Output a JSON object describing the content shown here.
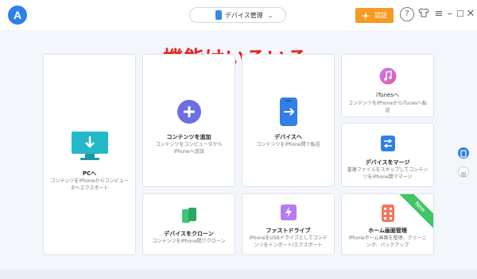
{
  "header": {
    "device_label": "デバイス管理",
    "device_chevron": "⌄",
    "auth_label": "認証"
  },
  "headline": "機能はいろいろ",
  "cards": {
    "pc": {
      "title": "PCへ",
      "desc": "コンテンツをiPhoneからコンピュータへエクスポート"
    },
    "add": {
      "title": "コンテンツを追加",
      "desc": "コンテンツをコンピュータからiPhoneへ追加"
    },
    "device": {
      "title": "デバイスへ",
      "desc": "コンテンツをiPhone間で転送"
    },
    "itunes": {
      "title": "iTunesへ",
      "desc": "コンテンツをiPhoneからiTunesへ転送"
    },
    "merge": {
      "title": "デバイスをマージ",
      "desc": "重複ファイルをスキップしてコンテンツをiPhone間でマージ"
    },
    "clone": {
      "title": "デバイスをクローン",
      "desc": "コンテンツをiPhone間でクローン"
    },
    "drive": {
      "title": "ファストドライブ",
      "desc": "iPhoneをUSBドライブとしてコンテンツをインポート/エクスポート"
    },
    "home": {
      "title": "ホーム画面管理",
      "desc": "iPhoneホーム画面を整理、クリーニング、バックアップ",
      "badge": "New"
    }
  },
  "colors": {
    "accent": "#2f80e8",
    "auth": "#f59a23",
    "headline": "#e8231c",
    "new_badge": "#42c566"
  }
}
